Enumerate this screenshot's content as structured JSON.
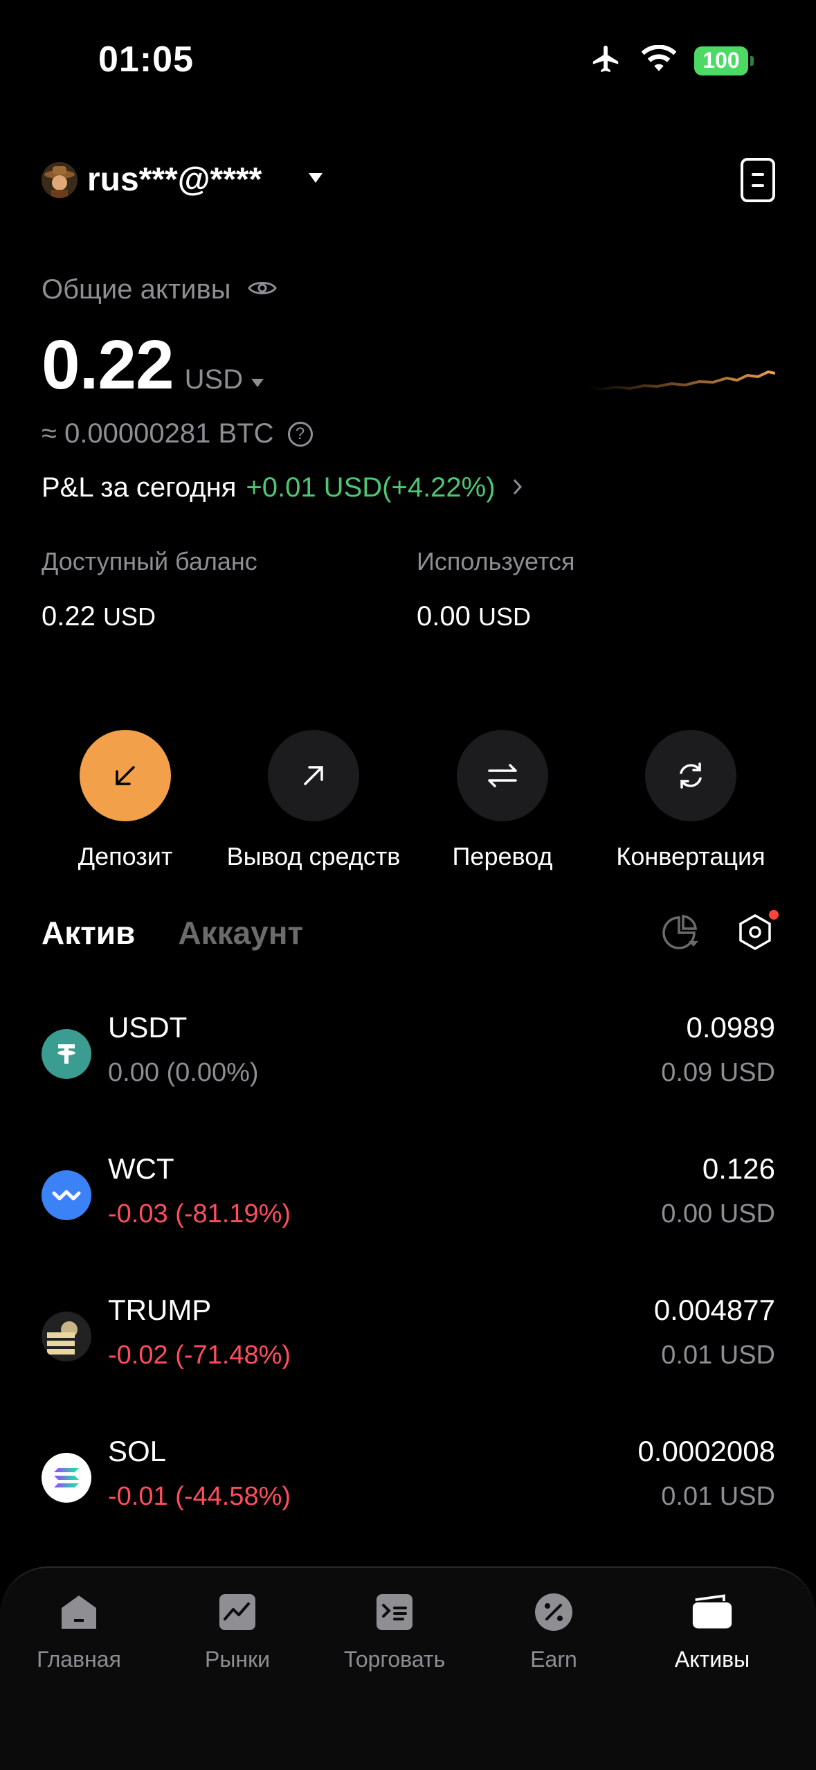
{
  "status_bar": {
    "time": "01:05",
    "battery": "100"
  },
  "header": {
    "username": "rus***@****"
  },
  "assets": {
    "label": "Общие активы",
    "total_value": "0.22",
    "currency": "USD",
    "btc_equivalent": "≈ 0.00000281 BTC",
    "pnl_label": "P&L за сегодня",
    "pnl_value": "+0.01 USD(+4.22%)"
  },
  "balances": {
    "available_label": "Доступный баланс",
    "available_value": "0.22",
    "available_currency": "USD",
    "used_label": "Используется",
    "used_value": "0.00",
    "used_currency": "USD"
  },
  "actions": [
    {
      "label": "Депозит"
    },
    {
      "label": "Вывод средств"
    },
    {
      "label": "Перевод"
    },
    {
      "label": "Конвертация"
    }
  ],
  "tabs": {
    "active": "Актив",
    "inactive": "Аккаунт"
  },
  "asset_list": [
    {
      "symbol": "USDT",
      "change": "0.00 (0.00%)",
      "amount": "0.0989",
      "usd": "0.09 USD"
    },
    {
      "symbol": "WCT",
      "change": "-0.03 (-81.19%)",
      "amount": "0.126",
      "usd": "0.00 USD"
    },
    {
      "symbol": "TRUMP",
      "change": "-0.02 (-71.48%)",
      "amount": "0.004877",
      "usd": "0.01 USD"
    },
    {
      "symbol": "SOL",
      "change": "-0.01 (-44.58%)",
      "amount": "0.0002008",
      "usd": "0.01 USD"
    }
  ],
  "nav": [
    {
      "label": "Главная",
      "icon": "home-icon"
    },
    {
      "label": "Рынки",
      "icon": "markets-icon"
    },
    {
      "label": "Торговать",
      "icon": "trade-icon"
    },
    {
      "label": "Earn",
      "icon": "earn-icon"
    },
    {
      "label": "Активы",
      "icon": "wallet-icon"
    }
  ],
  "colors": {
    "accent": "#f2a14a",
    "positive": "#4cc774",
    "negative": "#ff4d5e",
    "muted": "#8e8e93"
  }
}
